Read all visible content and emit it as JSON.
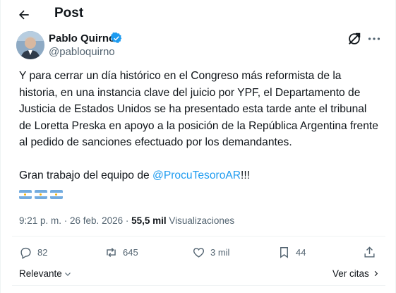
{
  "header": {
    "title": "Post"
  },
  "author": {
    "name": "Pablo Quirno",
    "handle": "@pabloquirno"
  },
  "tweet": {
    "lines": [
      "Y para cerrar un día histórico en el Congreso más reformista de la",
      "historia, en una instancia clave del juicio por YPF, el Departamento de",
      "Justicia de Estados Unidos se ha presentado esta tarde ante el tribunal",
      "de Loretta Preska en apoyo a la posición de la República Argentina frente",
      "al pedido de sanciones efectuado por los demandantes."
    ],
    "closing_prefix": "Gran trabajo del equipo de ",
    "closing_mention": "@ProcuTesoroAR",
    "closing_suffix": "!!!"
  },
  "meta": {
    "timestamp": "9:21 p. m. · 26 feb. 2026 · ",
    "views_count": "55,5 mil",
    "views_label": " Visualizaciones"
  },
  "actions": {
    "replies": "82",
    "reposts": "645",
    "likes": "3 mil",
    "bookmarks": "44"
  },
  "replies_sort": {
    "label": "Relevante"
  },
  "quotes": {
    "label": "Ver citas"
  },
  "icons": [
    "back-arrow-icon",
    "verified-badge-icon",
    "grok-icon",
    "more-icon",
    "reply-icon",
    "repost-icon",
    "like-icon",
    "bookmark-icon",
    "share-icon",
    "chevron-down-icon",
    "chevron-right-icon"
  ],
  "colors": {
    "accent": "#1d9bf0",
    "secondary_text": "#536471",
    "primary_text": "#0f1419",
    "divider": "#eff3f4"
  }
}
